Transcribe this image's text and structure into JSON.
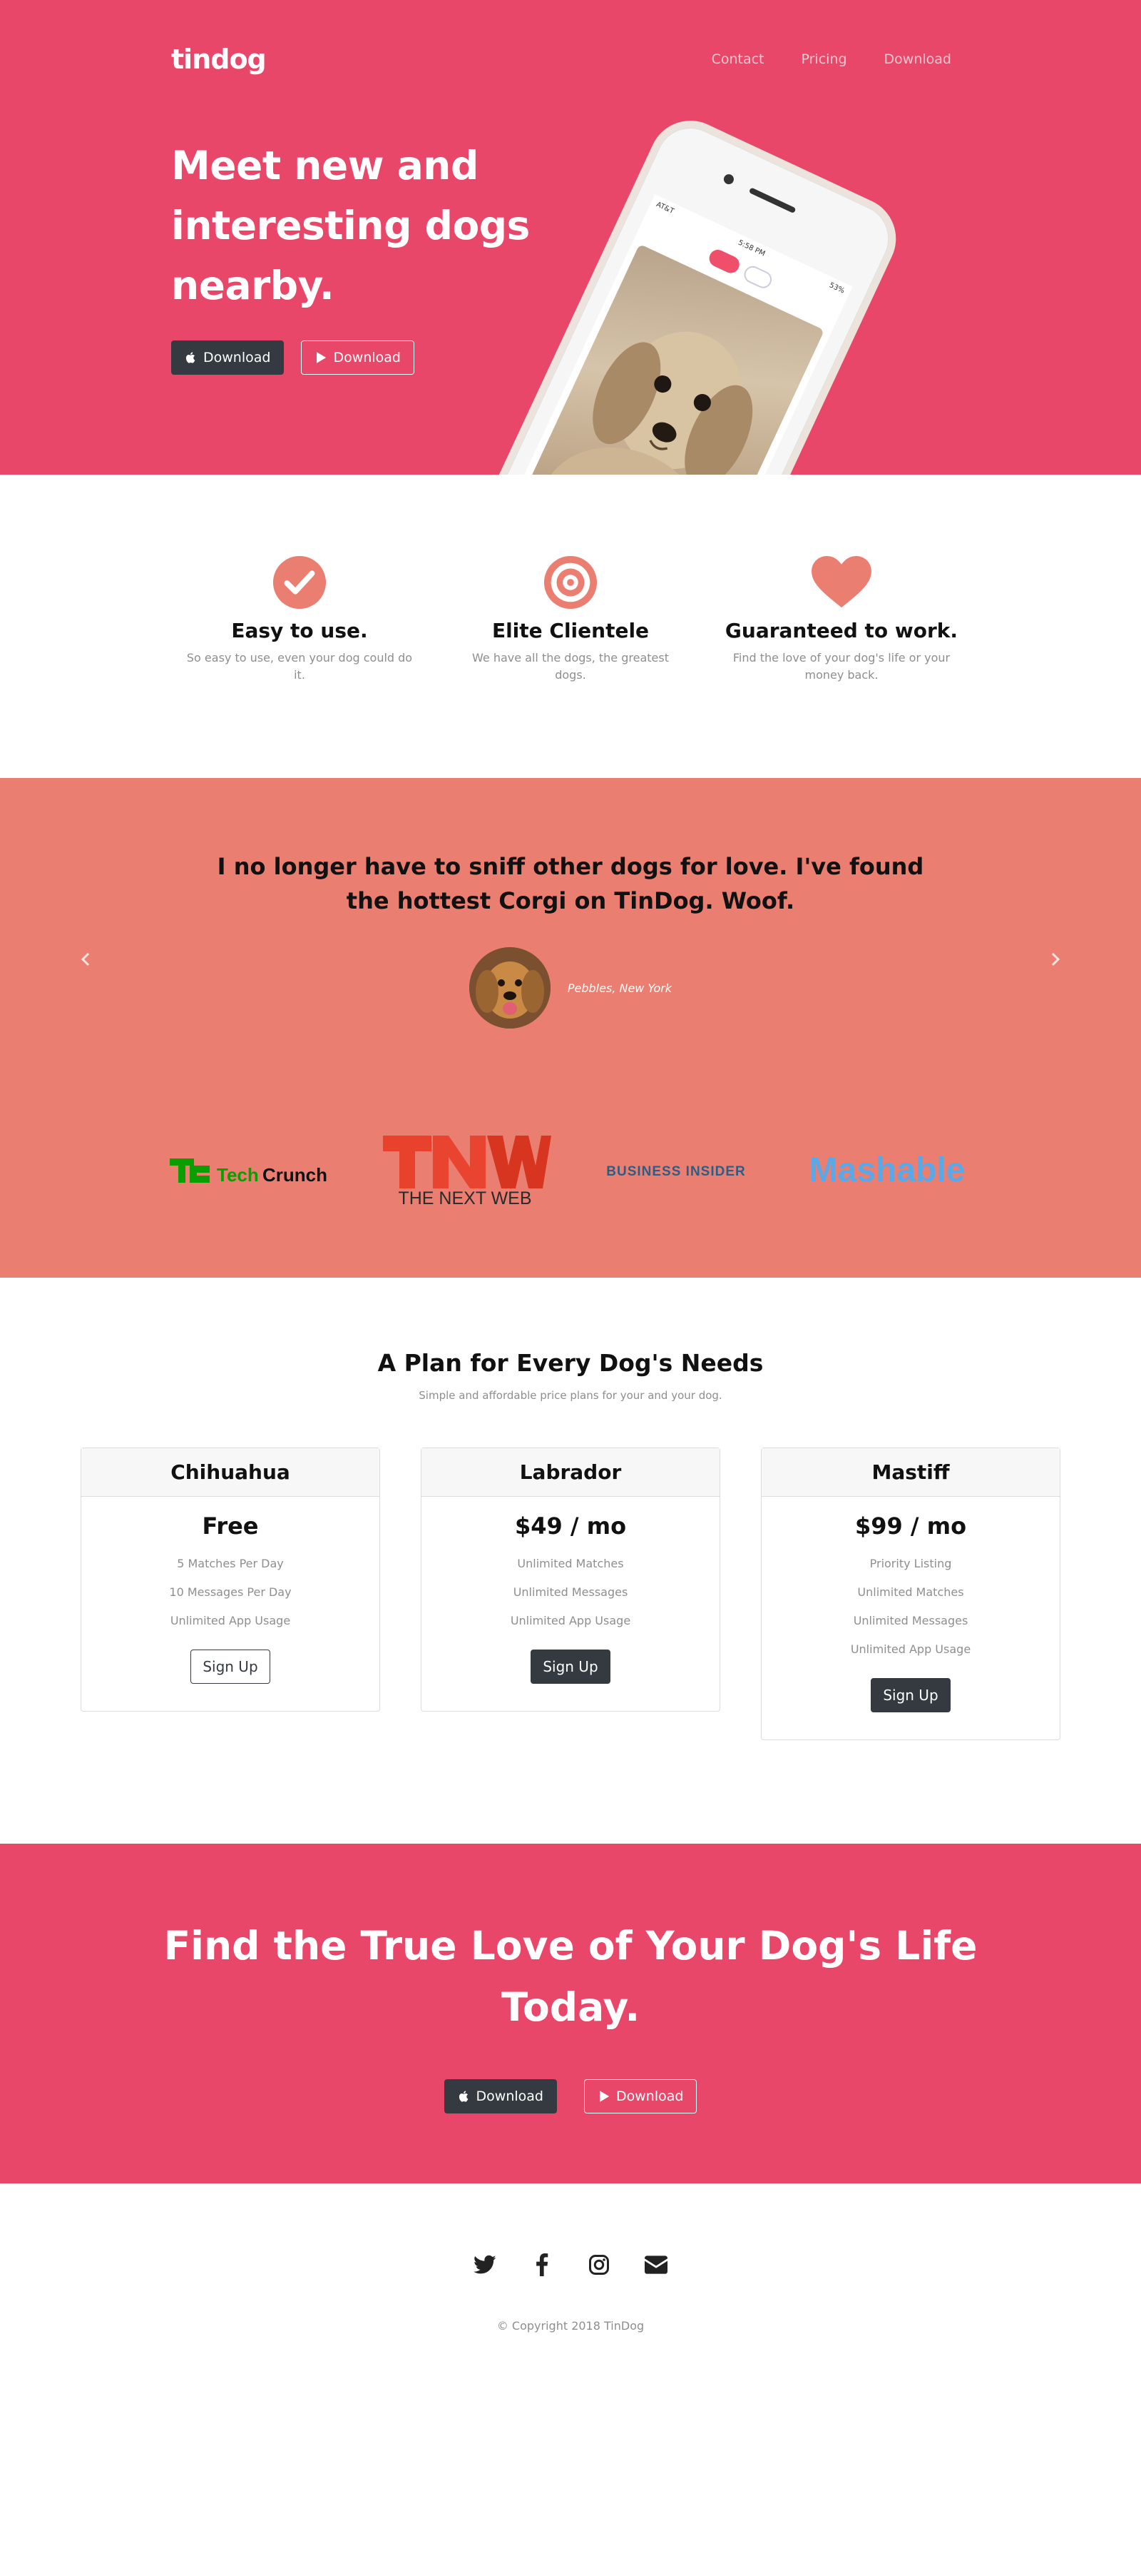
{
  "colors": {
    "brand_pink": "#e8476a",
    "salmon": "#ea7f71",
    "dark": "#343a40",
    "icon_salmon": "#ea7f71"
  },
  "nav": {
    "brand": "tindog",
    "links": [
      "Contact",
      "Pricing",
      "Download"
    ]
  },
  "hero": {
    "title": "Meet new and interesting dogs nearby.",
    "buttons": [
      {
        "label": "Download",
        "icon": "apple-icon"
      },
      {
        "label": "Download",
        "icon": "google-play-icon"
      }
    ],
    "phone": {
      "carrier": "AT&T",
      "time": "5:58 PM",
      "battery": "53%"
    }
  },
  "features": [
    {
      "icon": "check-circle-icon",
      "title": "Easy to use.",
      "text": "So easy to use, even your dog could do it."
    },
    {
      "icon": "bullseye-icon",
      "title": "Elite Clientele",
      "text": "We have all the dogs, the greatest dogs."
    },
    {
      "icon": "heart-icon",
      "title": "Guaranteed to work.",
      "text": "Find the love of your dog's life or your money back."
    }
  ],
  "testimonial": {
    "quote": "I no longer have to sniff other dogs for love. I've found the hottest Corgi on TinDog. Woof.",
    "author": "Pebbles, New York"
  },
  "press": [
    {
      "name": "TechCrunch",
      "mark": "TC"
    },
    {
      "name": "THE NEXT WEB",
      "mark": "TNW"
    },
    {
      "name": "BUSINESS INSIDER"
    },
    {
      "name": "Mashable"
    }
  ],
  "pricing": {
    "title": "A Plan for Every Dog's Needs",
    "subtitle": "Simple and affordable price plans for your and your dog.",
    "plans": [
      {
        "name": "Chihuahua",
        "price": "Free",
        "features": [
          "5 Matches Per Day",
          "10 Messages Per Day",
          "Unlimited App Usage"
        ],
        "button": "Sign Up"
      },
      {
        "name": "Labrador",
        "price": "$49 / mo",
        "features": [
          "Unlimited Matches",
          "Unlimited Messages",
          "Unlimited App Usage"
        ],
        "button": "Sign Up"
      },
      {
        "name": "Mastiff",
        "price": "$99 / mo",
        "features": [
          "Priority Listing",
          "Unlimited Matches",
          "Unlimited Messages",
          "Unlimited App Usage"
        ],
        "button": "Sign Up"
      }
    ]
  },
  "cta": {
    "title": "Find the True Love of Your Dog's Life Today.",
    "buttons": [
      {
        "label": "Download",
        "icon": "apple-icon"
      },
      {
        "label": "Download",
        "icon": "google-play-icon"
      }
    ]
  },
  "footer": {
    "social": [
      "twitter-icon",
      "facebook-icon",
      "instagram-icon",
      "envelope-icon"
    ],
    "copyright": "© Copyright 2018 TinDog"
  }
}
